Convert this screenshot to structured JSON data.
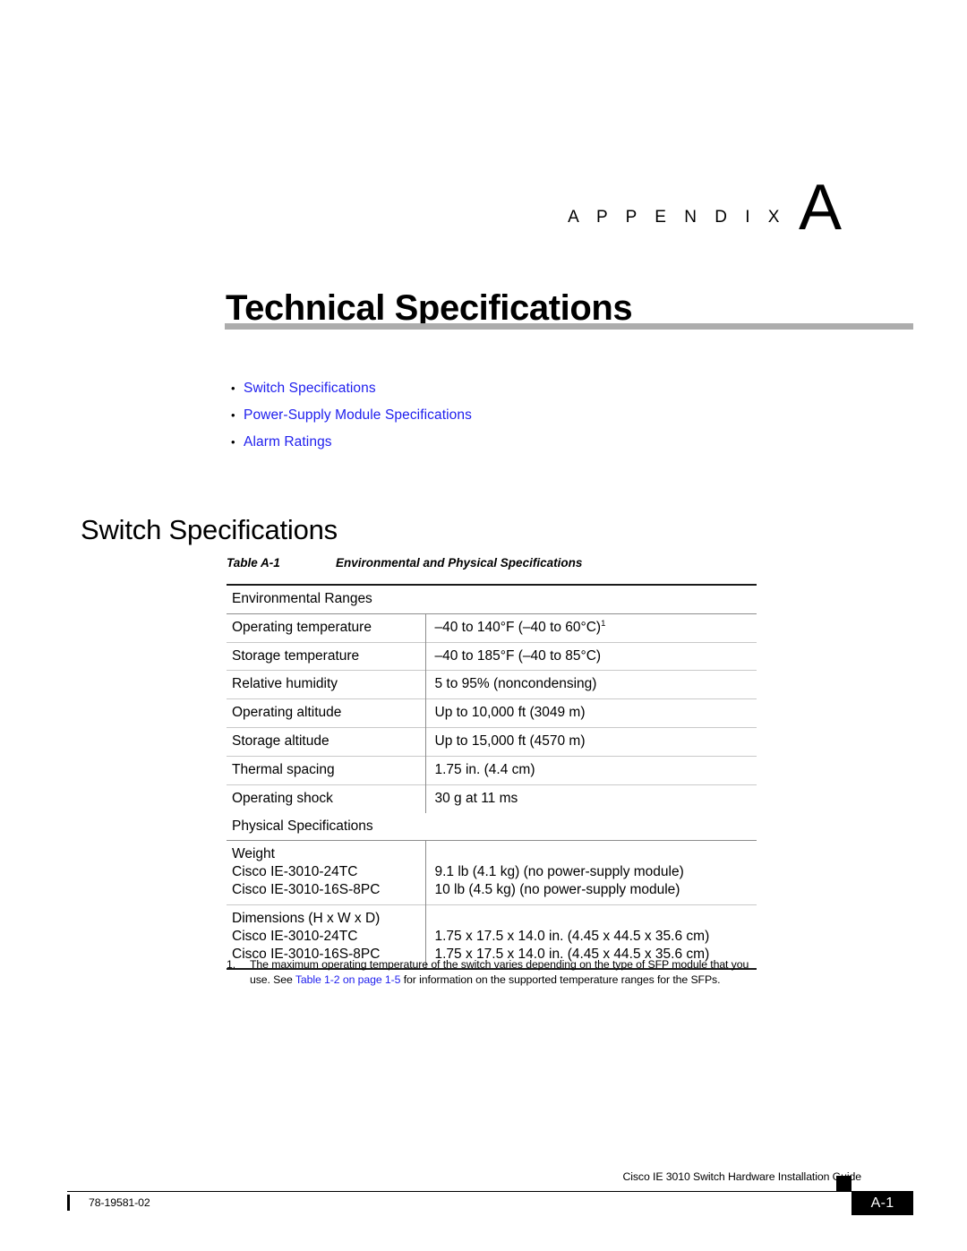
{
  "appendix": {
    "word": "A P P E N D I X",
    "letter": "A"
  },
  "chapter": {
    "title": "Technical Specifications"
  },
  "links": [
    {
      "label": "Switch Specifications"
    },
    {
      "label": "Power-Supply Module Specifications"
    },
    {
      "label": "Alarm Ratings"
    }
  ],
  "section": {
    "heading": "Switch Specifications"
  },
  "table": {
    "caption_label": "Table A-1",
    "caption_title": "Environmental and Physical Specifications",
    "sections": [
      {
        "heading": "Environmental Ranges",
        "rows": [
          {
            "label": "Operating temperature",
            "value": "–40 to 140°F (–40 to 60°C)",
            "footnote_marker": "1"
          },
          {
            "label": "Storage temperature",
            "value": "–40 to 185°F (–40 to 85°C)"
          },
          {
            "label": "Relative humidity",
            "value": "5 to 95% (noncondensing)"
          },
          {
            "label": "Operating altitude",
            "value": "Up to 10,000 ft (3049 m)"
          },
          {
            "label": "Storage altitude",
            "value": "Up to 15,000 ft (4570 m)"
          },
          {
            "label": "Thermal spacing",
            "value": "1.75 in. (4.4 cm)"
          },
          {
            "label": "Operating shock",
            "value": "30 g at 11 ms"
          }
        ]
      },
      {
        "heading": "Physical Specifications",
        "rows": [
          {
            "label_lines": [
              "Weight",
              "Cisco IE-3010-24TC",
              "Cisco IE-3010-16S-8PC"
            ],
            "value_lines": [
              "",
              "9.1 lb (4.1 kg) (no power-supply module)",
              "10 lb (4.5 kg) (no power-supply module)"
            ]
          },
          {
            "label_lines": [
              "Dimensions (H x W x D)",
              "Cisco IE-3010-24TC",
              "Cisco IE-3010-16S-8PC"
            ],
            "value_lines": [
              "",
              "1.75 x 17.5 x 14.0 in. (4.45 x 44.5 x 35.6 cm)",
              "1.75 x 17.5 x 14.0 in. (4.45 x 44.5 x 35.6 cm)"
            ]
          }
        ]
      }
    ]
  },
  "footnote": {
    "number": "1.",
    "text_before": "The maximum operating temperature of the switch varies depending on the type of SFP module that you use. See ",
    "link": "Table 1-2 on page 1-5",
    "text_after": " for information on the supported temperature ranges for the SFPs."
  },
  "footer": {
    "guide_title": "Cisco IE 3010 Switch Hardware Installation Guide",
    "page_number": "A-1",
    "doc_id": "78-19581-02"
  },
  "colors": {
    "link": "#2020ee",
    "title_rule": "#adadad",
    "table_border": "#1a1a1a"
  }
}
